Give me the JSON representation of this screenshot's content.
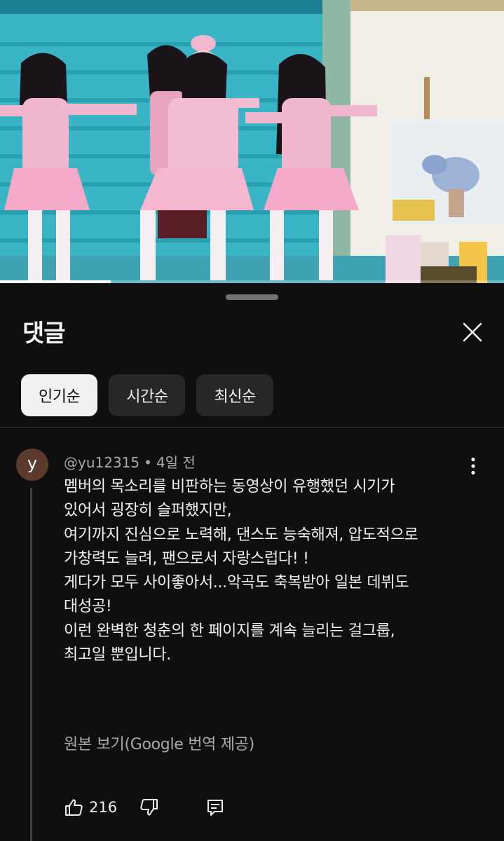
{
  "colors": {
    "background": "#0f0f0f",
    "chip_active_bg": "#f1f1f1",
    "chip_bg": "#272727",
    "text_primary": "#f1f1f1",
    "text_secondary": "#aaaaaa",
    "avatar_bg": "#5d3a2e"
  },
  "video": {
    "description_icon": "stage-performance-thumbnail",
    "progress_fraction": 0.22
  },
  "sheet": {
    "title": "댓글",
    "close_icon": "close-icon"
  },
  "sort_chips": [
    {
      "label": "인기순",
      "active": true
    },
    {
      "label": "시간순",
      "active": false
    },
    {
      "label": "최신순",
      "active": false
    }
  ],
  "comment": {
    "avatar_letter": "y",
    "author": "@yu12315",
    "separator": "•",
    "time": "4일 전",
    "lines": [
      "멤버의 목소리를 비판하는 동영상이 유행했던 시기가",
      "있어서 굉장히 슬퍼했지만,",
      "여기까지 진심으로 노력해, 댄스도 능숙해져, 압도적으로",
      "가창력도 늘려, 팬으로서 자랑스럽다! !",
      "게다가 모두 사이좋아서...악곡도 축복받아 일본 데뷔도",
      "대성공!",
      "이런 완벽한 청춘의 한 페이지를 계속 늘리는 걸그룹,",
      "최고일 뿐입니다."
    ],
    "translate_link": "원본 보기(Google 번역 제공)",
    "like_count": "216"
  }
}
